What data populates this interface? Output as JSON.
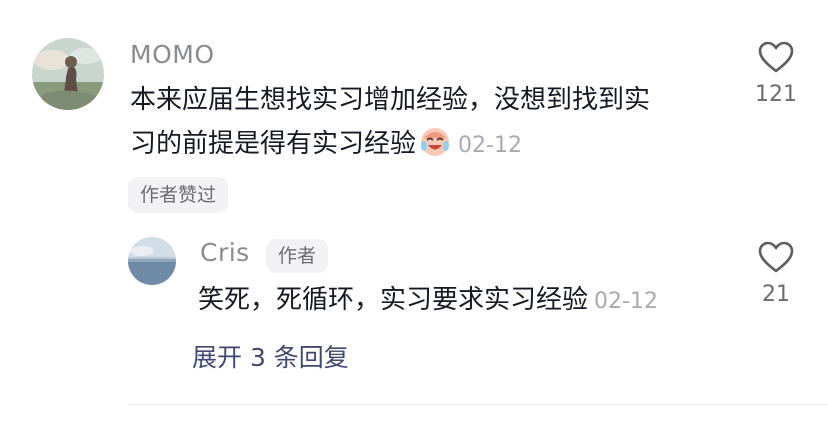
{
  "main_comment": {
    "username": "MOMO",
    "text_line1": "本来应届生想找实习增加经验，没想到找到实",
    "text_line2": "习的前提是得有实习经验",
    "emoji": "laughing-crying-emoji",
    "date": "02-12",
    "liked_by_author": "作者赞过",
    "like_count": "121"
  },
  "reply": {
    "username": "Cris",
    "author_badge": "作者",
    "text": "笑死，死循环，实习要求实习经验",
    "date": "02-12",
    "like_count": "21"
  },
  "expand_replies": "展开 3 条回复",
  "icons": {
    "like": "heart-outline-icon"
  },
  "colors": {
    "text": "#161823",
    "secondary": "#8a8b91",
    "link": "#3f4a70",
    "pill_bg": "#f2f2f4"
  }
}
